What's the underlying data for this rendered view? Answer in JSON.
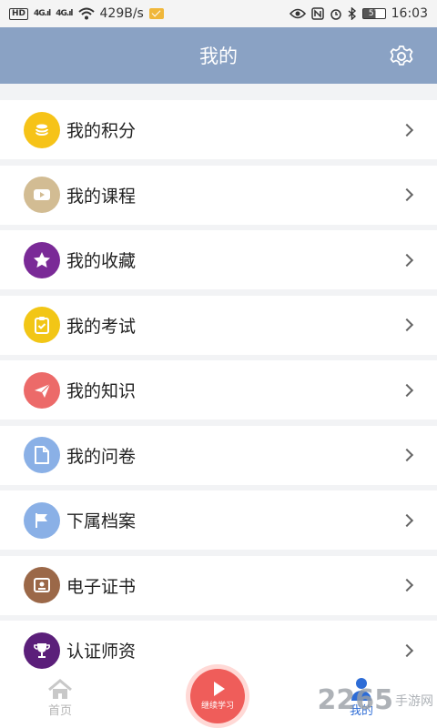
{
  "status_bar": {
    "hd": "HD",
    "signal1": "4G.ıl",
    "signal2": "4G.ıl",
    "speed": "429B/s",
    "battery": "57",
    "time": "16:03"
  },
  "header": {
    "title": "我的"
  },
  "menu": {
    "items": [
      {
        "label": "我的积分",
        "icon": "coin-icon",
        "color": "#f6c318"
      },
      {
        "label": "我的课程",
        "icon": "video-icon",
        "color": "#d2bc93"
      },
      {
        "label": "我的收藏",
        "icon": "star-icon",
        "color": "#7a2a97"
      },
      {
        "label": "我的考试",
        "icon": "clipboard-icon",
        "color": "#f2c616"
      },
      {
        "label": "我的知识",
        "icon": "paper-plane-icon",
        "color": "#ec6a69"
      },
      {
        "label": "我的问卷",
        "icon": "document-icon",
        "color": "#8ab0e6"
      },
      {
        "label": "下属档案",
        "icon": "flag-icon",
        "color": "#8ab0e6"
      },
      {
        "label": "电子证书",
        "icon": "certificate-icon",
        "color": "#9b6848"
      },
      {
        "label": "认证师资",
        "icon": "trophy-icon",
        "color": "#5b1f7a"
      }
    ]
  },
  "tab_bar": {
    "home_label": "首页",
    "continue_label": "继续学习",
    "mine_label": "我的"
  },
  "watermark": {
    "main": "2265",
    "sub": "手游网"
  }
}
